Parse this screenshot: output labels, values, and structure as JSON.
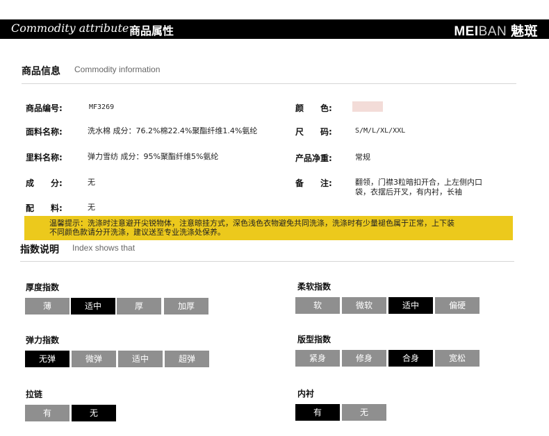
{
  "header": {
    "en_title": "Commodity attribute",
    "cn_title": "商品属性",
    "brand_a": "MEI",
    "brand_b": "BAN",
    "brand_c": "魅斑"
  },
  "info_section": {
    "title": "商品信息",
    "subtitle": "Commodity information"
  },
  "fields_left": [
    {
      "label": "商品编号:",
      "value": "MF3269"
    },
    {
      "label": "面料名称:",
      "value": "洗水棉 成分：76.2%棉22.4%聚酯纤维1.4%氨纶"
    },
    {
      "label": "里料名称:",
      "value": "弹力雪纺 成分：95%聚酯纤维5%氨纶"
    },
    {
      "label": "成　　分:",
      "value": "无"
    },
    {
      "label": "配　　料:",
      "value": "无"
    }
  ],
  "fields_right": [
    {
      "label": "颜　　色:",
      "value": ""
    },
    {
      "label": "尺　　码:",
      "value": "S/M/L/XL/XXL"
    },
    {
      "label": "产品净重:",
      "value": "常规"
    },
    {
      "label": "备　　注:",
      "value_line1": "翻领，门襟3粒暗扣开合，上左侧内口",
      "value_line2": "袋，衣摆后开叉，有内衬，长袖"
    }
  ],
  "color_swatch": "#f3dcd8",
  "notice": {
    "line1": "温馨提示：洗涤时注意避开尖锐物体，注意晾挂方式，深色浅色衣物避免共同洗涤，洗涤时有少量褪色属于正常，上下装",
    "line2": "不同颜色款请分开洗涤，建议送至专业洗涤处保养。"
  },
  "index_section": {
    "title": "指数说明",
    "subtitle": "Index shows that"
  },
  "indexes": [
    {
      "title": "厚度指数",
      "options": [
        "薄",
        "适中",
        "厚",
        "加厚"
      ],
      "selected": 1
    },
    {
      "title": "柔软指数",
      "options": [
        "软",
        "微软",
        "适中",
        "偏硬"
      ],
      "selected": 2
    },
    {
      "title": "弹力指数",
      "options": [
        "无弹",
        "微弹",
        "适中",
        "超弹"
      ],
      "selected": 0
    },
    {
      "title": "版型指数",
      "options": [
        "紧身",
        "修身",
        "合身",
        "宽松"
      ],
      "selected": 2
    },
    {
      "title": "拉链",
      "options": [
        "有",
        "无"
      ],
      "selected": 1
    },
    {
      "title": "内衬",
      "options": [
        "有",
        "无"
      ],
      "selected": 0
    }
  ]
}
